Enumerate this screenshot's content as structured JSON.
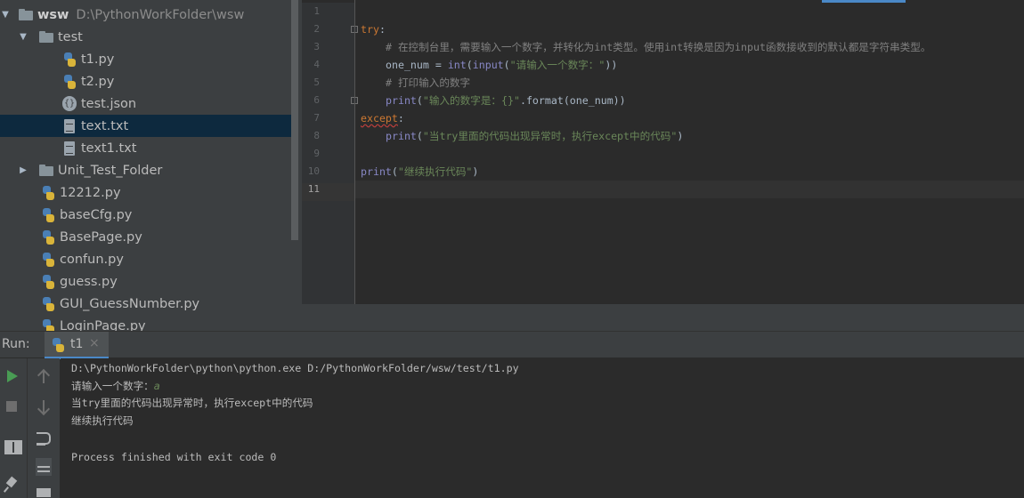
{
  "project": {
    "root": {
      "name": "wsw",
      "path": "D:\\PythonWorkFolder\\wsw"
    },
    "items": [
      {
        "label": "test",
        "type": "folder",
        "expanded": true
      },
      {
        "label": "t1.py",
        "type": "python"
      },
      {
        "label": "t2.py",
        "type": "python"
      },
      {
        "label": "test.json",
        "type": "json"
      },
      {
        "label": "text.txt",
        "type": "text",
        "selected": true
      },
      {
        "label": "text1.txt",
        "type": "text"
      },
      {
        "label": "Unit_Test_Folder",
        "type": "folder",
        "expanded": false
      },
      {
        "label": "12212.py",
        "type": "python"
      },
      {
        "label": "baseCfg.py",
        "type": "python"
      },
      {
        "label": "BasePage.py",
        "type": "python"
      },
      {
        "label": "confun.py",
        "type": "python"
      },
      {
        "label": "guess.py",
        "type": "python"
      },
      {
        "label": "GUI_GuessNumber.py",
        "type": "python"
      },
      {
        "label": "LoginPage.py",
        "type": "python"
      }
    ]
  },
  "editor": {
    "line_numbers": [
      "1",
      "2",
      "3",
      "4",
      "5",
      "6",
      "7",
      "8",
      "9",
      "10",
      "11"
    ],
    "current_line": "11",
    "code": {
      "l2_kw": "try",
      "l2_colon": ":",
      "l3_comment": "# 在控制台里，需要输入一个数字，并转化为int类型。使用int转换是因为input函数接收到的默认都是字符串类型。",
      "l4_var": "one_num = ",
      "l4_int": "int",
      "l4_paren": "(",
      "l4_input": "input",
      "l4_paren2": "(",
      "l4_str": "\"请输入一个数字：\"",
      "l4_close": "))",
      "l5_comment": "# 打印输入的数字",
      "l6_print": "print",
      "l6_paren": "(",
      "l6_str": "\"输入的数字是：{}\"",
      "l6_rest": ".format(one_num))",
      "l7_kw": "except",
      "l7_colon": ":",
      "l8_print": "print",
      "l8_paren": "(",
      "l8_str": "\"当try里面的代码出现异常时，执行except中的代码\"",
      "l8_close": ")",
      "l10_print": "print",
      "l10_paren": "(",
      "l10_str": "\"继续执行代码\"",
      "l10_close": ")"
    }
  },
  "run": {
    "label": "Run:",
    "tab_label": "t1",
    "tab_close": "×",
    "console": {
      "command": "D:\\PythonWorkFolder\\python\\python.exe D:/PythonWorkFolder/wsw/test/t1.py",
      "prompt": "请输入一个数字：",
      "user_input": "a",
      "line3": "当try里面的代码出现异常时，执行except中的代码",
      "line4": "继续执行代码",
      "exit": "Process finished with exit code 0"
    }
  },
  "colors": {
    "keyword": "#cc7832",
    "string": "#6a8759",
    "comment": "#808080",
    "builtin": "#8888c6",
    "selection": "#0d293e",
    "accent": "#4a88c7"
  }
}
